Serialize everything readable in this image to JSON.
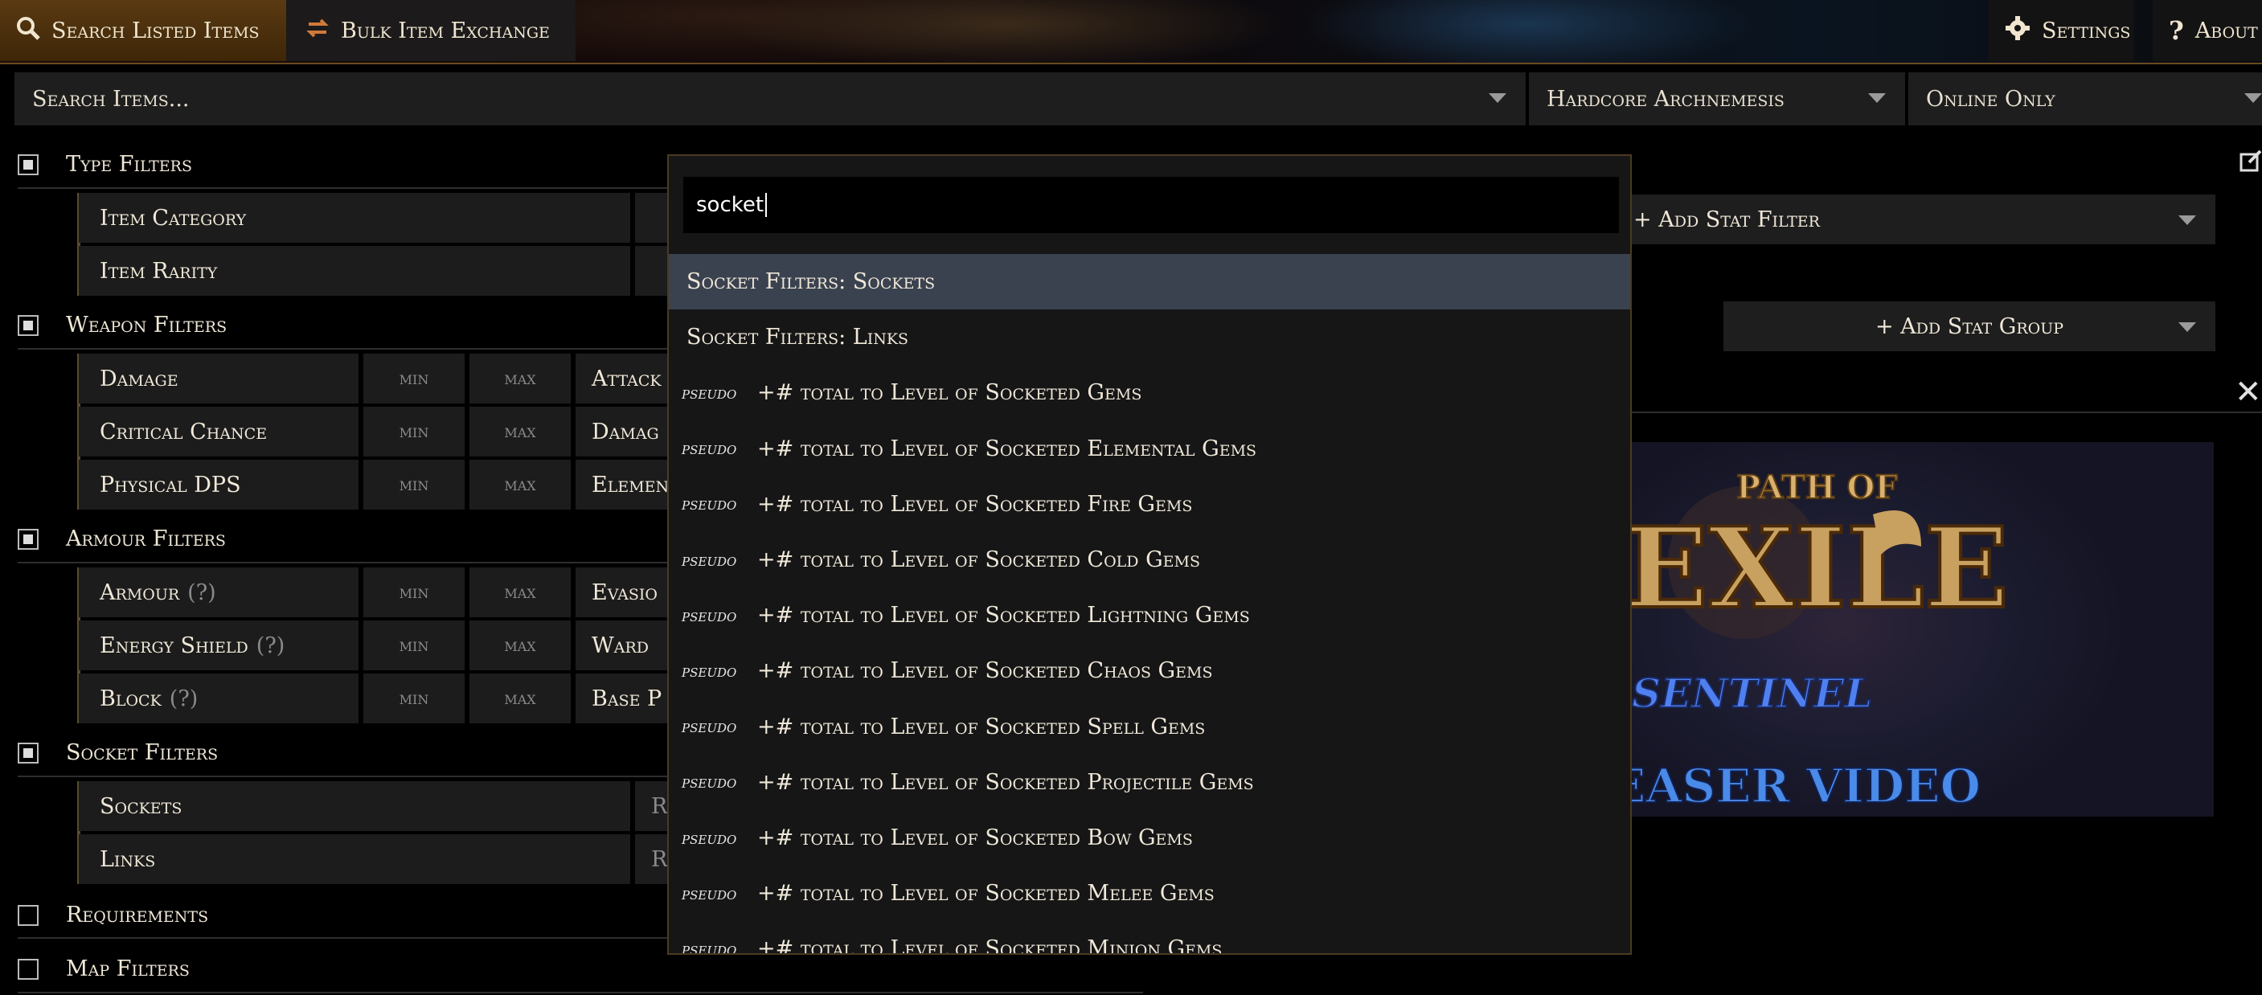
{
  "nav": {
    "search_tab": "Search Listed Items",
    "bulk_tab": "Bulk Item Exchange",
    "settings": "Settings",
    "about": "About"
  },
  "search": {
    "placeholder": "Search Items...",
    "league": "Hardcore Archnemesis",
    "status": "Online Only"
  },
  "groups": {
    "type": "Type Filters",
    "weapon": "Weapon Filters",
    "armour": "Armour Filters",
    "socket": "Socket Filters",
    "requirements": "Requirements",
    "map": "Map Filters"
  },
  "type_filters": {
    "category": "Item Category",
    "rarity": "Item Rarity"
  },
  "weapon_filters": {
    "rows": [
      {
        "label": "Damage",
        "min": "min",
        "max": "max",
        "tail": "Attack"
      },
      {
        "label": "Critical Chance",
        "min": "min",
        "max": "max",
        "tail": "Damag"
      },
      {
        "label": "Physical DPS",
        "min": "min",
        "max": "max",
        "tail": "Elemen"
      }
    ]
  },
  "armour_filters": {
    "q": "(?)",
    "rows": [
      {
        "label": "Armour",
        "min": "min",
        "max": "max",
        "tail": "Evasio"
      },
      {
        "label": "Energy Shield",
        "min": "min",
        "max": "max",
        "tail": "Ward"
      },
      {
        "label": "Block",
        "min": "min",
        "max": "max",
        "tail": "Base P"
      }
    ]
  },
  "socket_filters": {
    "sockets": "Sockets",
    "links": "Links",
    "tail": "R"
  },
  "right": {
    "add_stat_filter": "+ Add Stat Filter",
    "add_stat_group": "+ Add Stat Group"
  },
  "banner": {
    "line1": "PATH OF",
    "line2": "EXILE",
    "line3": "SENTINEL",
    "line4": "TEASER VIDEO"
  },
  "dropdown": {
    "query": "socket",
    "items": [
      {
        "tag": "",
        "text": "Socket Filters: Sockets"
      },
      {
        "tag": "",
        "text": "Socket Filters: Links"
      },
      {
        "tag": "pseudo",
        "text": "+# total to Level of Socketed Gems"
      },
      {
        "tag": "pseudo",
        "text": "+# total to Level of Socketed Elemental Gems"
      },
      {
        "tag": "pseudo",
        "text": "+# total to Level of Socketed Fire Gems"
      },
      {
        "tag": "pseudo",
        "text": "+# total to Level of Socketed Cold Gems"
      },
      {
        "tag": "pseudo",
        "text": "+# total to Level of Socketed Lightning Gems"
      },
      {
        "tag": "pseudo",
        "text": "+# total to Level of Socketed Chaos Gems"
      },
      {
        "tag": "pseudo",
        "text": "+# total to Level of Socketed Spell Gems"
      },
      {
        "tag": "pseudo",
        "text": "+# total to Level of Socketed Projectile Gems"
      },
      {
        "tag": "pseudo",
        "text": "+# total to Level of Socketed Bow Gems"
      },
      {
        "tag": "pseudo",
        "text": "+# total to Level of Socketed Melee Gems"
      },
      {
        "tag": "pseudo",
        "text": "+# total to Level of Socketed Minion Gems"
      }
    ]
  }
}
